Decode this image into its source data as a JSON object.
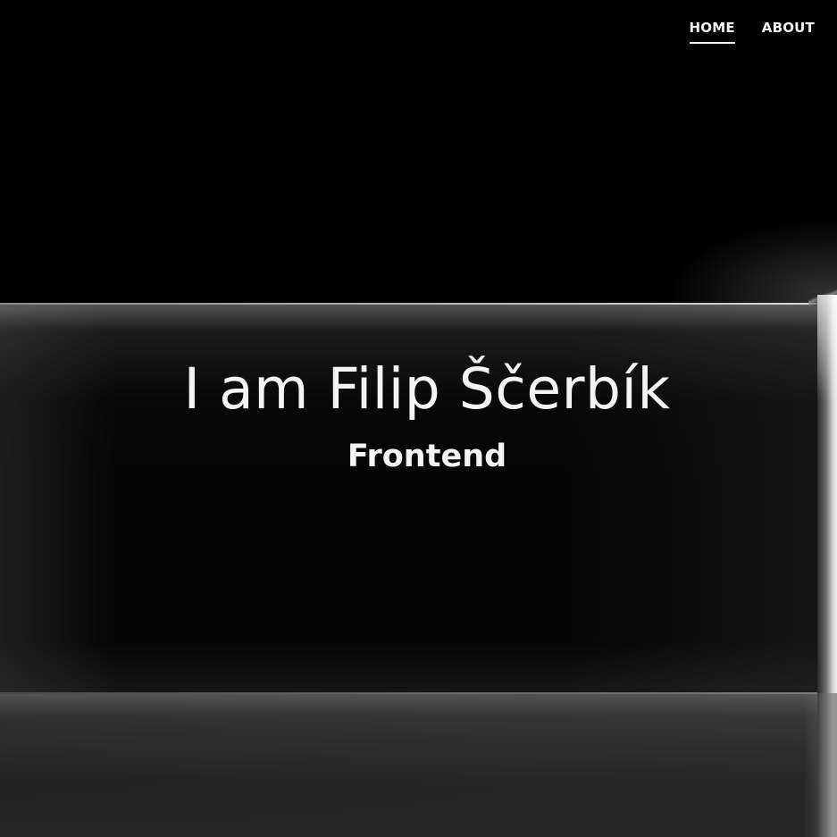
{
  "nav": {
    "items": [
      {
        "label": "HOME",
        "active": true
      },
      {
        "label": "ABOUT",
        "active": false
      }
    ]
  },
  "hero": {
    "title": "I am Filip Ščerbík",
    "subtitle": "Frontend"
  }
}
